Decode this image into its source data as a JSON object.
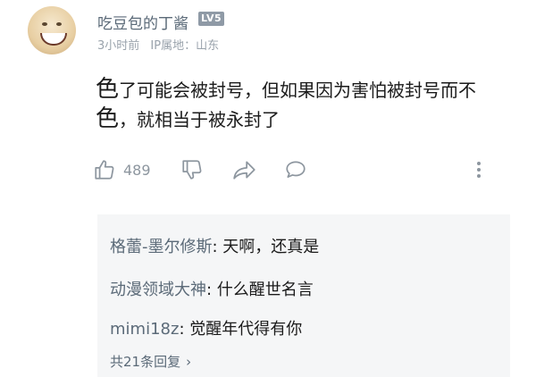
{
  "comment": {
    "username": "吃豆包的丁酱",
    "badge": "LV5",
    "time": "3小时前",
    "ip_location": "IP属地：山东",
    "content": {
      "part1_big": "色",
      "part1": "了可能会被封号，但如果因为害怕被封号而不",
      "part2_big": "色",
      "part2": "，就相当于被永封了"
    },
    "like_count": "489",
    "icons": {
      "like": "thumbs-up-icon",
      "dislike": "thumbs-down-icon",
      "share": "share-icon",
      "reply": "comment-bubble-icon",
      "more": "more-vertical-icon"
    }
  },
  "replies": [
    {
      "author": "格蕾-墨尔修斯",
      "text": "天啊，还真是"
    },
    {
      "author": "动漫领域大神",
      "text": "什么醒世名言"
    },
    {
      "author": "mimi18z",
      "text": "觉醒年代得有你"
    }
  ],
  "replies_more": "共21条回复"
}
